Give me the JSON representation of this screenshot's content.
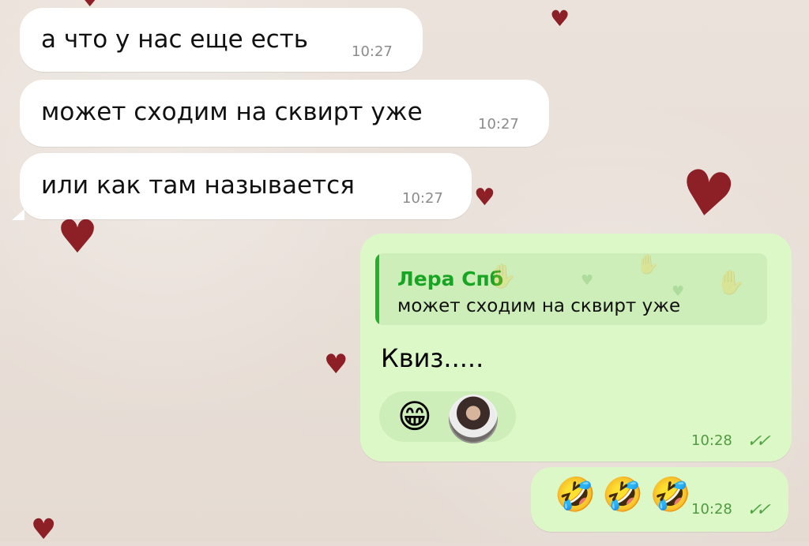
{
  "theme": {
    "incoming_bg": "#ffffff",
    "outgoing_bg": "#dcf8c6",
    "reply_accent": "#23b12c",
    "wallpaper_bg": "#e7ddd6",
    "heart_color": "#8d1f26"
  },
  "messages": [
    {
      "text": "а что у нас еще есть",
      "time": "10:27"
    },
    {
      "text": "может сходим на сквирт уже",
      "time": "10:27"
    },
    {
      "text": "или как там называется",
      "time": "10:27"
    }
  ],
  "reply_message": {
    "quoted_name": "Лера Спб",
    "quoted_text": "может сходим на сквирт уже",
    "text": "Квиз.....",
    "reaction_emoji": "😁",
    "time": "10:28",
    "status": "✓✓"
  },
  "emoji_message": {
    "text": "🤣🤣🤣",
    "time": "10:28",
    "status": "✓✓"
  },
  "icons": {
    "background_hearts": "heart-icon",
    "reaction_avatar": "avatar",
    "read_receipt": "double-check-icon"
  }
}
